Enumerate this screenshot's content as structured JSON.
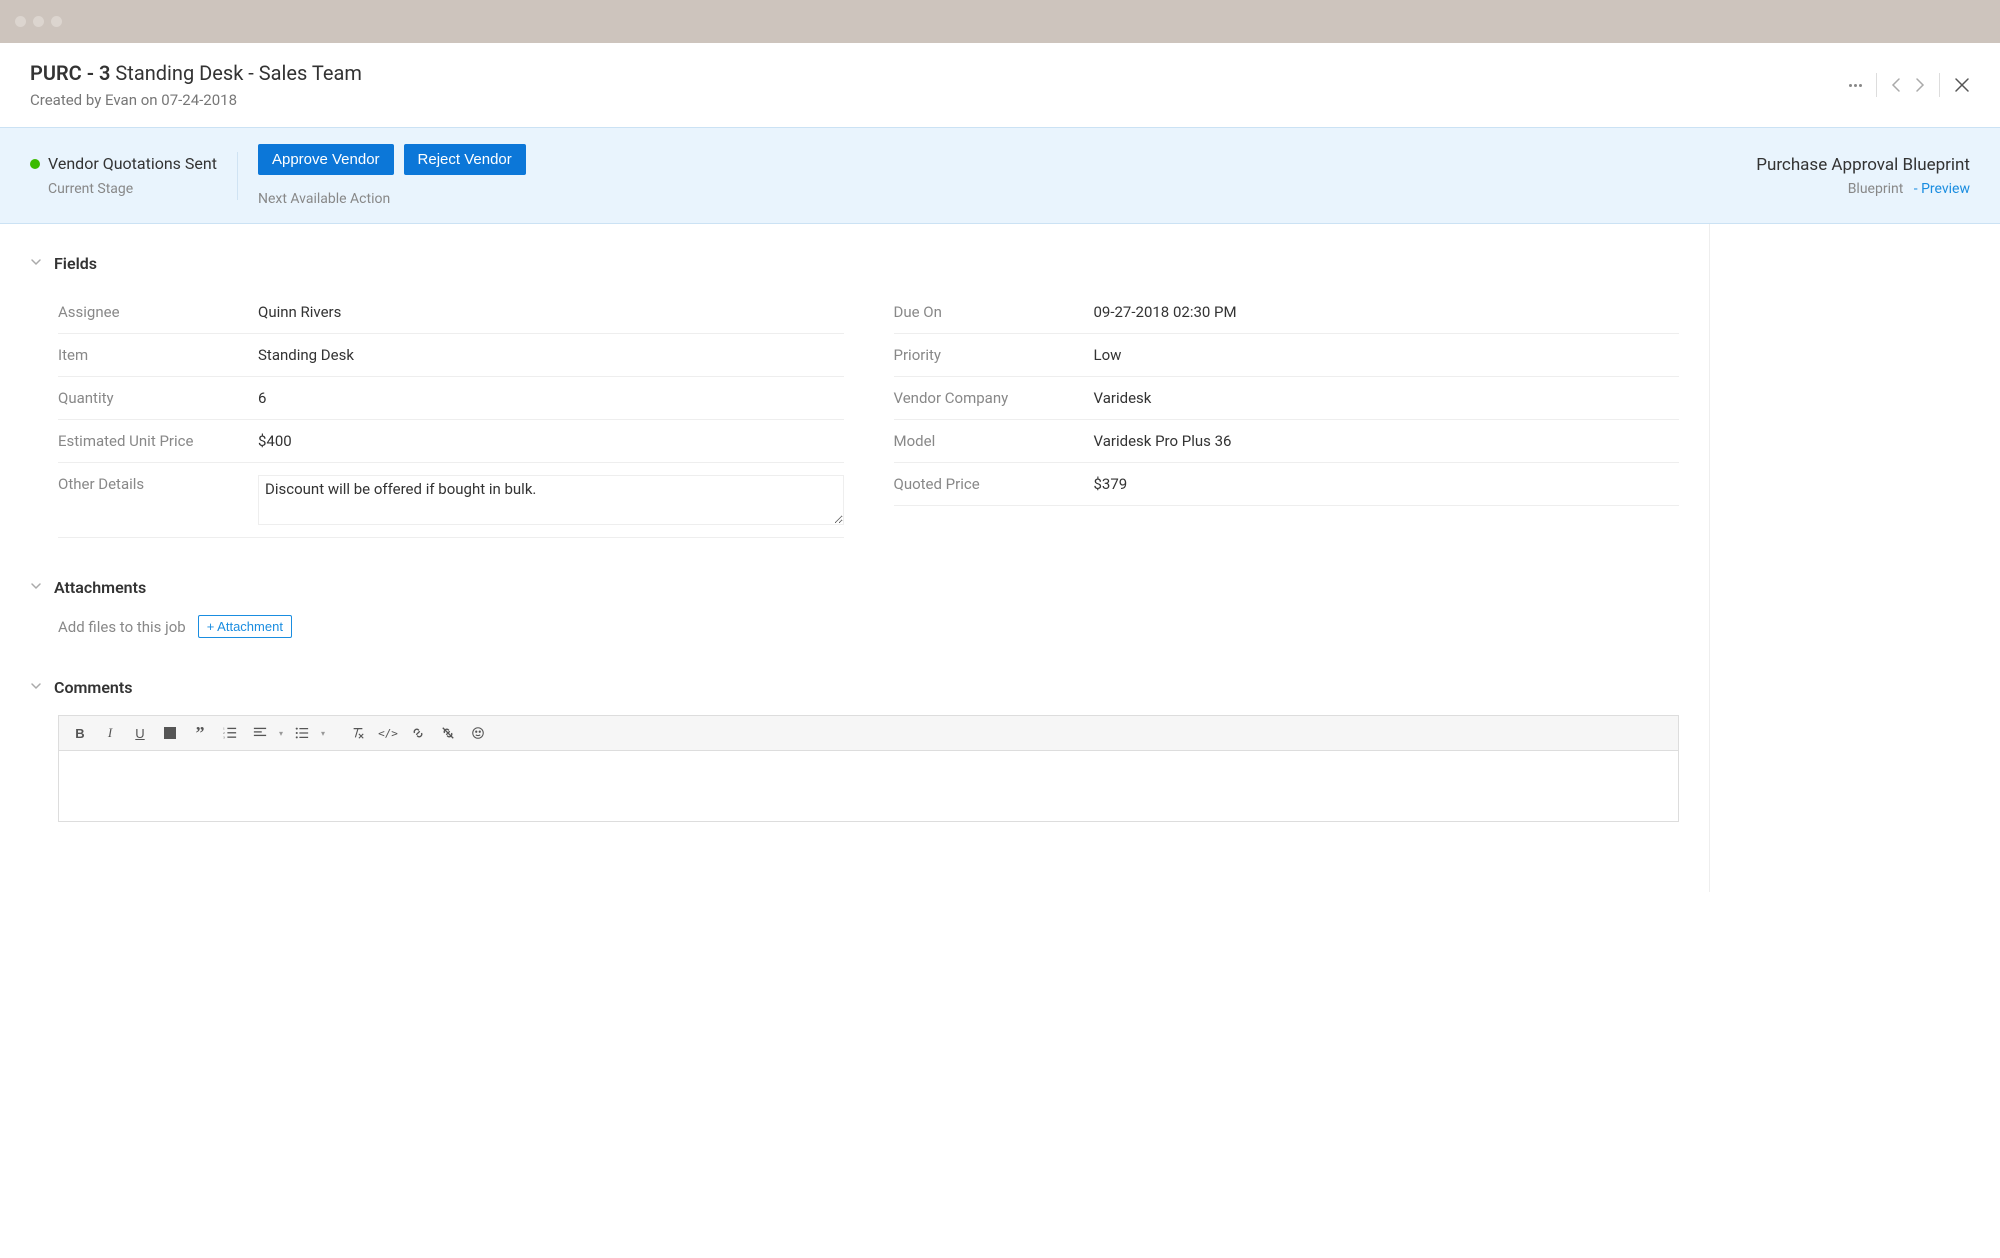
{
  "header": {
    "title_prefix": "PURC - 3",
    "title_suffix": "Standing Desk - Sales Team",
    "created_by_label": "Created by",
    "created_by_name": "Evan",
    "created_on_label": "on",
    "created_on_date": "07-24-2018"
  },
  "stage": {
    "current_stage_name": "Vendor Quotations Sent",
    "current_stage_label": "Current Stage",
    "actions": {
      "approve": "Approve Vendor",
      "reject": "Reject Vendor"
    },
    "next_action_label": "Next Available Action",
    "blueprint_title": "Purchase Approval Blueprint",
    "blueprint_label": "Blueprint",
    "preview_label": "- Preview"
  },
  "sections": {
    "fields_label": "Fields",
    "attachments_label": "Attachments",
    "comments_label": "Comments"
  },
  "fields": {
    "left": [
      {
        "label": "Assignee",
        "value": "Quinn Rivers"
      },
      {
        "label": "Item",
        "value": "Standing Desk"
      },
      {
        "label": "Quantity",
        "value": "6"
      },
      {
        "label": "Estimated Unit Price",
        "value": "$400"
      },
      {
        "label": "Other Details",
        "value": "Discount will be offered if bought in bulk.",
        "textarea": true
      }
    ],
    "right": [
      {
        "label": "Due On",
        "value": "09-27-2018 02:30 PM"
      },
      {
        "label": "Priority",
        "value": "Low"
      },
      {
        "label": "Vendor Company",
        "value": "Varidesk"
      },
      {
        "label": "Model",
        "value": "Varidesk Pro Plus 36"
      },
      {
        "label": "Quoted Price",
        "value": "$379"
      }
    ]
  },
  "attachments": {
    "prompt": "Add files to this job",
    "button": "+ Attachment"
  }
}
